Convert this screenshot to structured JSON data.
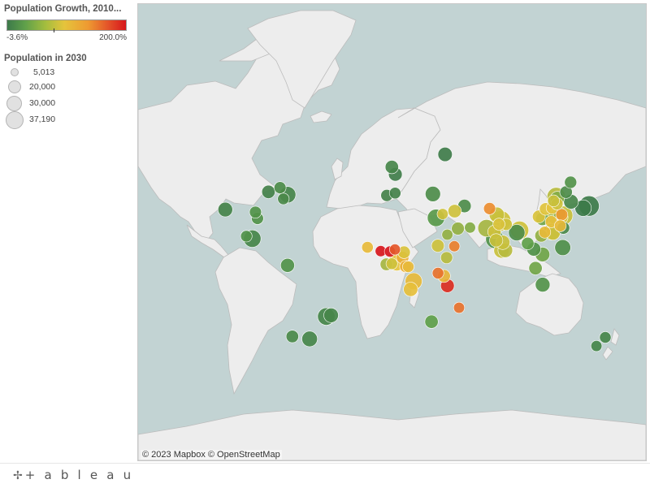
{
  "legend": {
    "color_title": "Population Growth, 2010...",
    "color_min_label": "-3.6%",
    "color_max_label": "200.0%",
    "size_title": "Population in 2030",
    "size_items": [
      {
        "label": "5,013",
        "value": 5013
      },
      {
        "label": "20,000",
        "value": 20000
      },
      {
        "label": "30,000",
        "value": 30000
      },
      {
        "label": "37,190",
        "value": 37190
      }
    ]
  },
  "map": {
    "attribution": "© 2023 Mapbox © OpenStreetMap",
    "colors": {
      "ocean": "#c2d3d3",
      "land": "#ededed",
      "border": "#bcbcbc"
    },
    "cities": [
      {
        "lon": 139.7,
        "lat": 35.7,
        "growth": -3.0,
        "pop": 37190
      },
      {
        "lon": 135.5,
        "lat": 34.7,
        "growth": -3.2,
        "pop": 20000
      },
      {
        "lon": 121.5,
        "lat": 31.2,
        "growth": 55,
        "pop": 30000
      },
      {
        "lon": 116.4,
        "lat": 39.9,
        "growth": 50,
        "pop": 28000
      },
      {
        "lon": 126.9,
        "lat": 37.6,
        "growth": 5,
        "pop": 14000
      },
      {
        "lon": 113.3,
        "lat": 23.1,
        "growth": 40,
        "pop": 22000
      },
      {
        "lon": 114.1,
        "lat": 22.5,
        "growth": 60,
        "pop": 14000
      },
      {
        "lon": 121.5,
        "lat": 25.0,
        "growth": 8,
        "pop": 8000
      },
      {
        "lon": 106.6,
        "lat": 29.6,
        "growth": 30,
        "pop": 10000
      },
      {
        "lon": 117.2,
        "lat": 39.1,
        "growth": 35,
        "pop": 12000
      },
      {
        "lon": 114.3,
        "lat": 30.6,
        "growth": 45,
        "pop": 11000
      },
      {
        "lon": 104.1,
        "lat": 30.7,
        "growth": 70,
        "pop": 9000
      },
      {
        "lon": 120.2,
        "lat": 30.3,
        "growth": 65,
        "pop": 9000
      },
      {
        "lon": 118.8,
        "lat": 32.1,
        "growth": 40,
        "pop": 8500
      },
      {
        "lon": 123.4,
        "lat": 41.8,
        "growth": 10,
        "pop": 8000
      },
      {
        "lon": 108.9,
        "lat": 34.3,
        "growth": 75,
        "pop": 8000
      },
      {
        "lon": 120.3,
        "lat": 31.6,
        "growth": 120,
        "pop": 7000
      },
      {
        "lon": 126.6,
        "lat": 45.8,
        "growth": 15,
        "pop": 7500
      },
      {
        "lon": 113.6,
        "lat": 34.8,
        "growth": 80,
        "pop": 7500
      },
      {
        "lon": 117.0,
        "lat": 36.7,
        "growth": 60,
        "pop": 7000
      },
      {
        "lon": 112.9,
        "lat": 28.2,
        "growth": 85,
        "pop": 7000
      },
      {
        "lon": 119.3,
        "lat": 26.1,
        "growth": 90,
        "pop": 6500
      },
      {
        "lon": 108.3,
        "lat": 22.8,
        "growth": 90,
        "pop": 6500
      },
      {
        "lon": 114.5,
        "lat": 38.0,
        "growth": 55,
        "pop": 6500
      },
      {
        "lon": 106.7,
        "lat": 10.8,
        "growth": 30,
        "pop": 14000
      },
      {
        "lon": 105.8,
        "lat": 21.0,
        "growth": 40,
        "pop": 9000
      },
      {
        "lon": 100.5,
        "lat": 13.75,
        "growth": 15,
        "pop": 12000
      },
      {
        "lon": 96.2,
        "lat": 16.8,
        "growth": 25,
        "pop": 8000
      },
      {
        "lon": 106.8,
        "lat": -6.2,
        "growth": 15,
        "pop": 14000
      },
      {
        "lon": 101.7,
        "lat": 3.1,
        "growth": 30,
        "pop": 10000
      },
      {
        "lon": 121.0,
        "lat": 14.6,
        "growth": 12,
        "pop": 18000
      },
      {
        "lon": 77.2,
        "lat": 28.6,
        "growth": 60,
        "pop": 36000
      },
      {
        "lon": 72.9,
        "lat": 19.1,
        "growth": 15,
        "pop": 28000
      },
      {
        "lon": 88.4,
        "lat": 22.6,
        "growth": 10,
        "pop": 20000
      },
      {
        "lon": 90.4,
        "lat": 23.8,
        "growth": 60,
        "pop": 28000
      },
      {
        "lon": 80.3,
        "lat": 13.1,
        "growth": 50,
        "pop": 14000
      },
      {
        "lon": 77.6,
        "lat": 12.97,
        "growth": 55,
        "pop": 16000
      },
      {
        "lon": 78.5,
        "lat": 17.4,
        "growth": 55,
        "pop": 13000
      },
      {
        "lon": 72.6,
        "lat": 23.0,
        "growth": 60,
        "pop": 10000
      },
      {
        "lon": 67.0,
        "lat": 24.9,
        "growth": 45,
        "pop": 24000
      },
      {
        "lon": 74.3,
        "lat": 31.55,
        "growth": 55,
        "pop": 16000
      },
      {
        "lon": 73.85,
        "lat": 18.5,
        "growth": 55,
        "pop": 10000
      },
      {
        "lon": 80.9,
        "lat": 26.85,
        "growth": 60,
        "pop": 7000
      },
      {
        "lon": 75.8,
        "lat": 26.9,
        "growth": 70,
        "pop": 7000
      },
      {
        "lon": 69.2,
        "lat": 34.5,
        "growth": 130,
        "pop": 7000
      },
      {
        "lon": 51.4,
        "lat": 35.7,
        "growth": 10,
        "pop": 10000
      },
      {
        "lon": 44.4,
        "lat": 33.3,
        "growth": 60,
        "pop": 10000
      },
      {
        "lon": 46.7,
        "lat": 24.7,
        "growth": 40,
        "pop": 9000
      },
      {
        "lon": 55.3,
        "lat": 25.2,
        "growth": 35,
        "pop": 5013
      },
      {
        "lon": 39.2,
        "lat": 21.5,
        "growth": 40,
        "pop": 5013
      },
      {
        "lon": 44.2,
        "lat": 15.3,
        "growth": 140,
        "pop": 5013
      },
      {
        "lon": 28.95,
        "lat": 41.0,
        "growth": 10,
        "pop": 16000
      },
      {
        "lon": 31.2,
        "lat": 30.05,
        "growth": 20,
        "pop": 24000
      },
      {
        "lon": 35.9,
        "lat": 31.9,
        "growth": 60,
        "pop": 5013
      },
      {
        "lon": 37.6,
        "lat": 55.75,
        "growth": -2,
        "pop": 13000
      },
      {
        "lon": 2.35,
        "lat": 48.85,
        "growth": -1,
        "pop": 11000
      },
      {
        "lon": -0.1,
        "lat": 51.5,
        "growth": 5,
        "pop": 10000
      },
      {
        "lon": -3.7,
        "lat": 40.4,
        "growth": 2,
        "pop": 7000
      },
      {
        "lon": 2.2,
        "lat": 41.4,
        "growth": 2,
        "pop": 6000
      },
      {
        "lon": 3.4,
        "lat": 6.5,
        "growth": 80,
        "pop": 24000
      },
      {
        "lon": 15.3,
        "lat": -4.3,
        "growth": 90,
        "pop": 22000
      },
      {
        "lon": 13.2,
        "lat": -8.8,
        "growth": 85,
        "pop": 13000
      },
      {
        "lon": 36.8,
        "lat": -1.3,
        "growth": 95,
        "pop": 9000
      },
      {
        "lon": 39.3,
        "lat": -6.8,
        "growth": 190,
        "pop": 11000
      },
      {
        "lon": 32.6,
        "lat": 0.3,
        "growth": 150,
        "pop": 6000
      },
      {
        "lon": 38.7,
        "lat": 9.0,
        "growth": 50,
        "pop": 7000
      },
      {
        "lon": 32.5,
        "lat": 15.6,
        "growth": 60,
        "pop": 9000
      },
      {
        "lon": 28.0,
        "lat": -26.2,
        "growth": 25,
        "pop": 10000
      },
      {
        "lon": 47.5,
        "lat": -18.9,
        "growth": 150,
        "pop": 5013
      },
      {
        "lon": -0.2,
        "lat": 5.6,
        "growth": 60,
        "pop": 6000
      },
      {
        "lon": -4.0,
        "lat": 5.3,
        "growth": 45,
        "pop": 8000
      },
      {
        "lon": -17.4,
        "lat": 14.7,
        "growth": 90,
        "pop": 6000
      },
      {
        "lon": -8.0,
        "lat": 12.6,
        "growth": 200,
        "pop": 5013
      },
      {
        "lon": -1.5,
        "lat": 12.4,
        "growth": 200,
        "pop": 5013
      },
      {
        "lon": 7.5,
        "lat": 9.05,
        "growth": 100,
        "pop": 8000
      },
      {
        "lon": 8.5,
        "lat": 12.0,
        "growth": 70,
        "pop": 8000
      },
      {
        "lon": 2.1,
        "lat": 13.5,
        "growth": 170,
        "pop": 5013
      },
      {
        "lon": 9.7,
        "lat": 4.05,
        "growth": 100,
        "pop": 7000
      },
      {
        "lon": 11.5,
        "lat": 3.9,
        "growth": 90,
        "pop": 6000
      },
      {
        "lon": -74.0,
        "lat": 40.7,
        "growth": 4,
        "pop": 20000
      },
      {
        "lon": -118.2,
        "lat": 34.05,
        "growth": 3,
        "pop": 14000
      },
      {
        "lon": -87.6,
        "lat": 41.9,
        "growth": 2,
        "pop": 10000
      },
      {
        "lon": -79.4,
        "lat": 43.65,
        "growth": 10,
        "pop": 7000
      },
      {
        "lon": -77.0,
        "lat": 38.9,
        "growth": 8,
        "pop": 6000
      },
      {
        "lon": -95.4,
        "lat": 29.8,
        "growth": 15,
        "pop": 7000
      },
      {
        "lon": -96.8,
        "lat": 32.8,
        "growth": 15,
        "pop": 7000
      },
      {
        "lon": -99.1,
        "lat": 19.4,
        "growth": 5,
        "pop": 24000
      },
      {
        "lon": -103.3,
        "lat": 20.7,
        "growth": 15,
        "pop": 6000
      },
      {
        "lon": -74.1,
        "lat": 4.7,
        "growth": 15,
        "pop": 12000
      },
      {
        "lon": -46.6,
        "lat": -23.55,
        "growth": 5,
        "pop": 24000
      },
      {
        "lon": -43.2,
        "lat": -22.9,
        "growth": 5,
        "pop": 14000
      },
      {
        "lon": -58.4,
        "lat": -34.6,
        "growth": 5,
        "pop": 17000
      },
      {
        "lon": -70.65,
        "lat": -33.45,
        "growth": 8,
        "pop": 8000
      },
      {
        "lon": 151.2,
        "lat": -33.85,
        "growth": 5,
        "pop": 6000
      },
      {
        "lon": 144.95,
        "lat": -37.8,
        "growth": 5,
        "pop": 5013
      }
    ]
  },
  "footer": {
    "logo_mark": "✢",
    "logo_text": "+ a b l e a u"
  }
}
